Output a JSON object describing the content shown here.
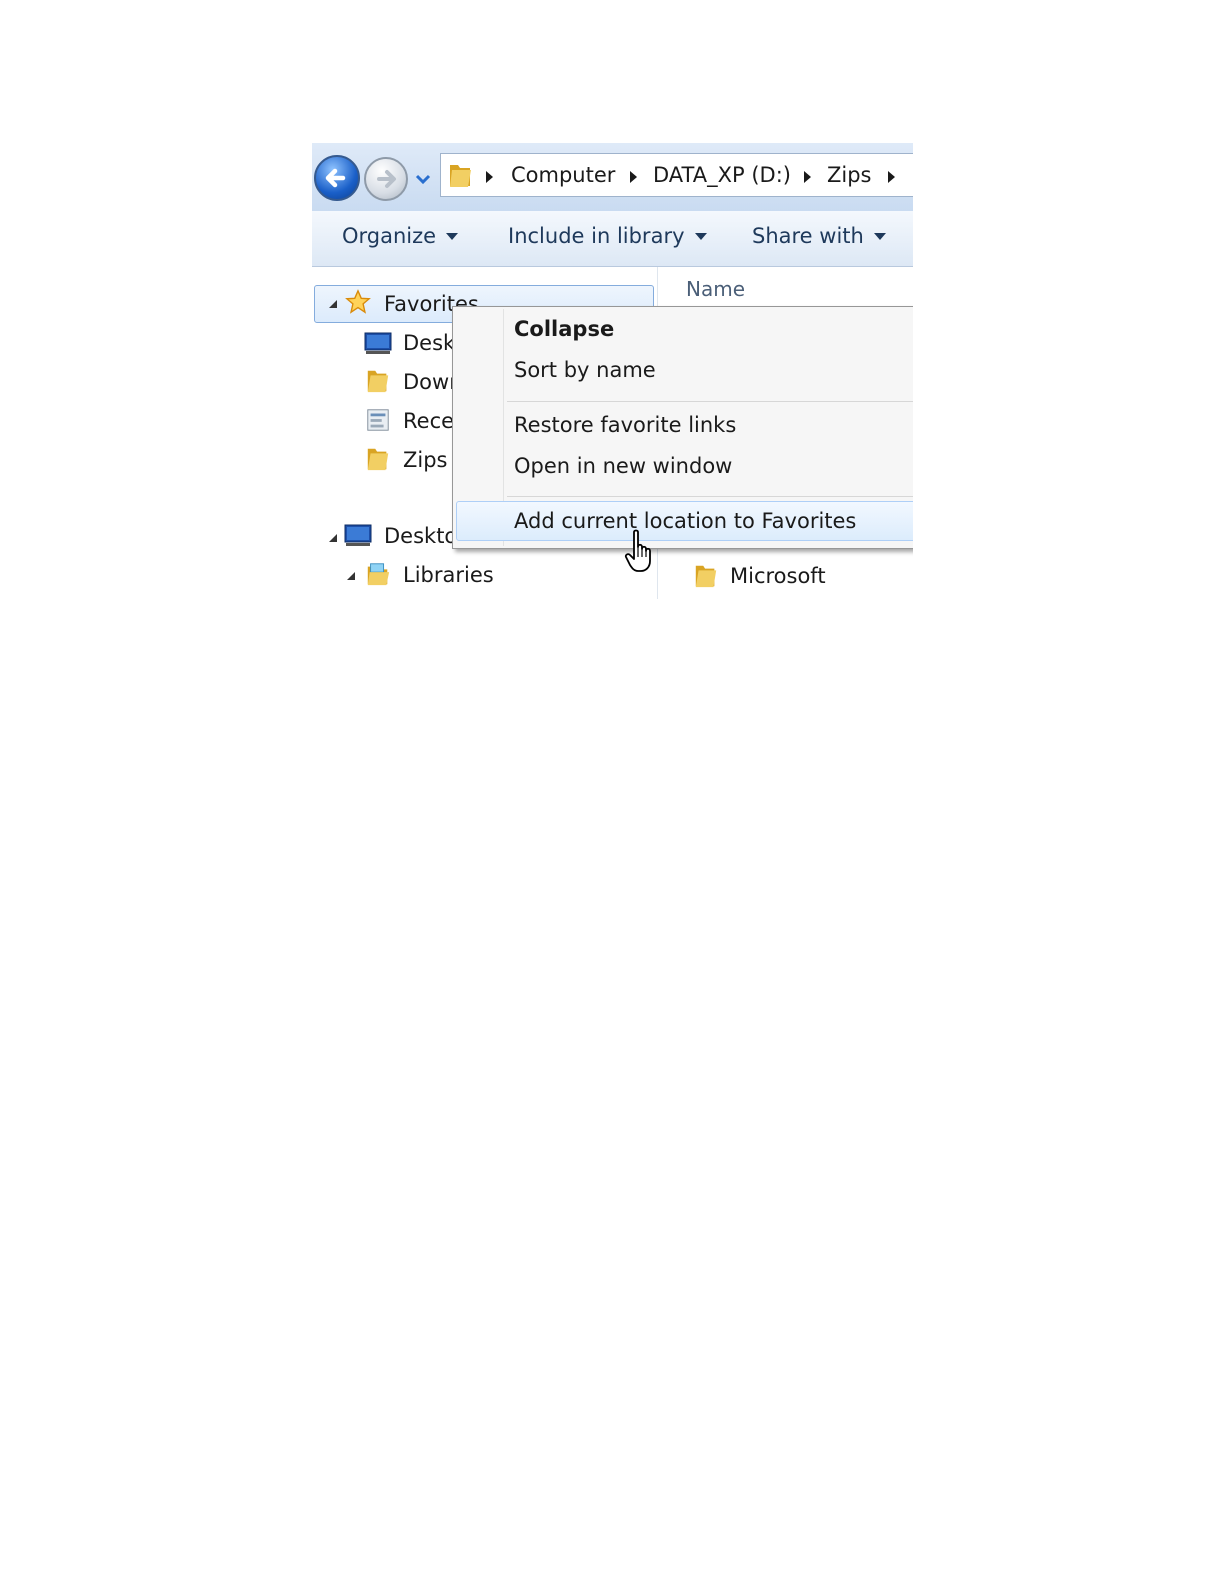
{
  "address_bar": {
    "breadcrumb": [
      "Computer",
      "DATA_XP (D:)",
      "Zips"
    ]
  },
  "toolbar": {
    "organize": "Organize",
    "include_in_library": "Include in library",
    "share_with": "Share with"
  },
  "nav_pane": {
    "favorites": "Favorites",
    "favorite_items": [
      "Desk",
      "Dowr",
      "Rece",
      "Zips"
    ],
    "desktop": "Deskto",
    "libraries": "Libraries"
  },
  "file_list": {
    "column_name": "Name",
    "visible_items": [
      "Microsoft"
    ]
  },
  "context_menu": {
    "items": [
      "Collapse",
      "Sort by name",
      "Restore favorite links",
      "Open in new window",
      "Add current location to Favorites"
    ],
    "hovered_index": 4
  },
  "colors": {
    "selection_border": "#84acdd",
    "toolbar_text": "#1e395b",
    "folder_yellow": "#e8b83a"
  }
}
